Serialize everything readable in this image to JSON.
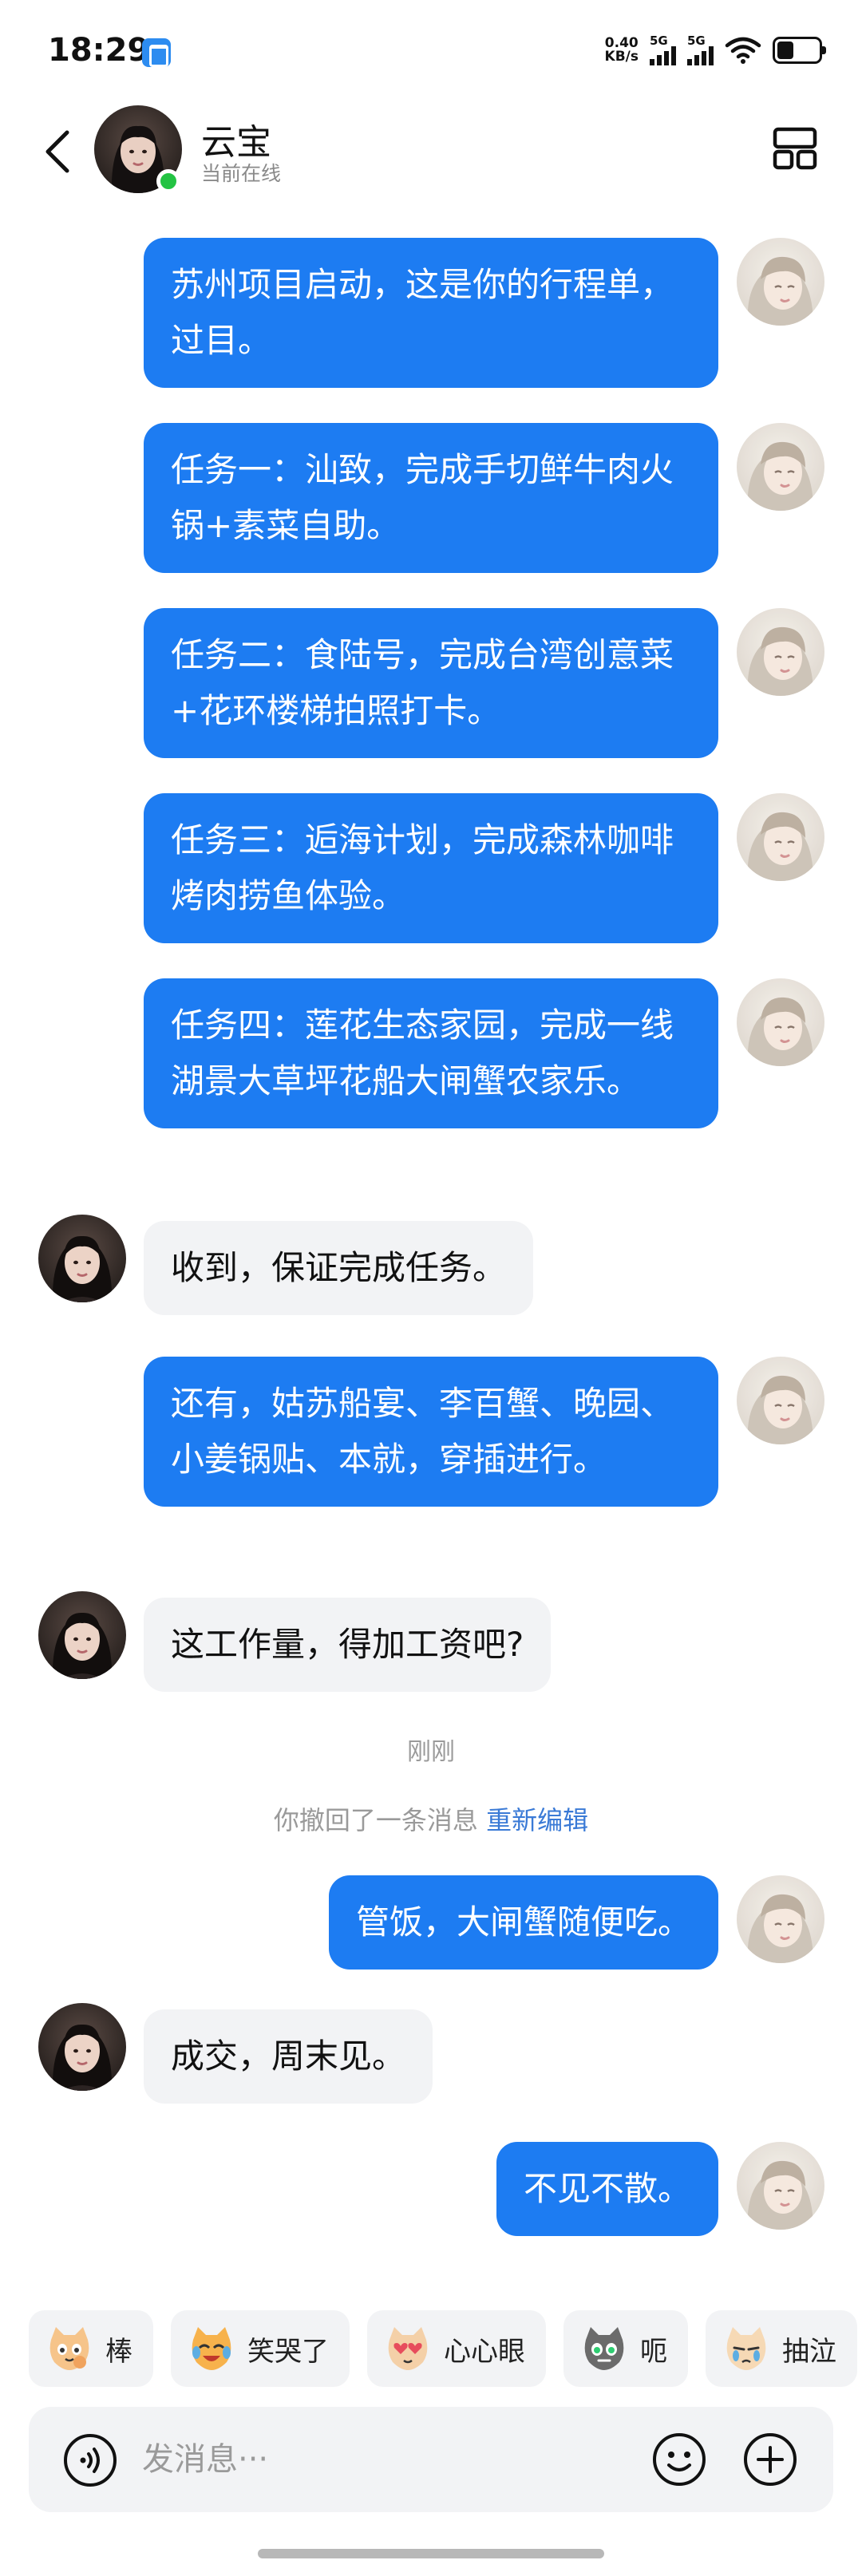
{
  "status_bar": {
    "time": "18:29",
    "net_speed_value": "0.40",
    "net_speed_unit": "KB/s",
    "sim1_label": "5G",
    "sim2_label": "5G",
    "battery_level": 0.4
  },
  "header": {
    "contact_name": "云宝",
    "contact_status": "当前在线"
  },
  "messages": [
    {
      "from": "me",
      "text": "苏州项目启动，这是你的行程单，过目。"
    },
    {
      "from": "me",
      "text": "任务一：汕致，完成手切鲜牛肉火锅+素菜自助。"
    },
    {
      "from": "me",
      "text": "任务二：食陆号，完成台湾创意菜+花环楼梯拍照打卡。"
    },
    {
      "from": "me",
      "text": "任务三：逅海计划，完成森林咖啡烤肉捞鱼体验。"
    },
    {
      "from": "me",
      "text": "任务四：莲花生态家园，完成一线湖景大草坪花船大闸蟹农家乐。"
    },
    {
      "from": "them",
      "text": "收到，保证完成任务。"
    },
    {
      "from": "me",
      "text": "还有，姑苏船宴、李百蟹、晚园、小姜锅贴、本就，穿插进行。"
    },
    {
      "from": "them",
      "text": "这工作量，得加工资吧?"
    },
    {
      "from": "me",
      "text": "管饭，大闸蟹随便吃。"
    },
    {
      "from": "them",
      "text": "成交，周末见。"
    },
    {
      "from": "me",
      "text": "不见不散。"
    }
  ],
  "timestamp": "刚刚",
  "recall_notice": {
    "text": "你撤回了一条消息",
    "action": "重新编辑"
  },
  "quick_reactions": [
    {
      "icon": "cat-thumbs-up-icon",
      "label": "棒"
    },
    {
      "icon": "cat-laugh-cry-icon",
      "label": "笑哭了"
    },
    {
      "icon": "cat-heart-eyes-icon",
      "label": "心心眼"
    },
    {
      "icon": "cat-awkward-icon",
      "label": "呃"
    },
    {
      "icon": "cat-sob-icon",
      "label": "抽泣"
    }
  ],
  "input": {
    "placeholder": "发消息···"
  },
  "colors": {
    "outgoing_bubble": "#1d7cf2",
    "incoming_bubble": "#f2f3f5",
    "online_dot": "#23c343",
    "link": "#3a7ad6"
  }
}
